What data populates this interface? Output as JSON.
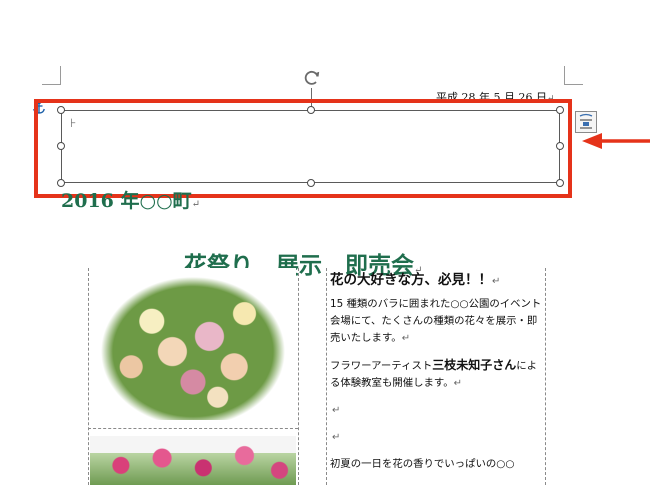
{
  "document": {
    "date_text": "平成 28 年 5 月 26 日",
    "textbox": {
      "cursor_mark": "⊦"
    },
    "title_year": "2016 年○○町",
    "title_main": "花祭り　展示　即売会",
    "right_column": {
      "heading": "花の大好きな方、必見！！",
      "para1": "15 種類のバラに囲まれた○○公園のイベント会場にて、たくさんの種類の花々を展示・即売いたします。",
      "para2_prefix": "フラワーアーティスト",
      "para2_name": "三枝未知子さん",
      "para2_suffix": "による体験教室も開催します。",
      "para3": "初夏の一日を花の香りでいっぱいの○○"
    },
    "paragraph_mark": "↵"
  },
  "icons": {
    "anchor": "anchor-icon",
    "rotate": "rotate-handle-icon",
    "layout_options": "layout-options-icon",
    "callout_arrow": "arrow-left-icon"
  },
  "colors": {
    "highlight_frame": "#e5331a",
    "title_green": "#1f6e4d",
    "arrow": "#e5331a"
  }
}
